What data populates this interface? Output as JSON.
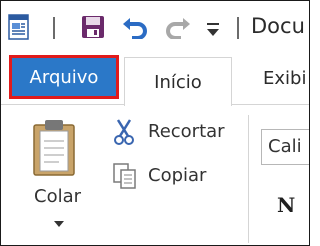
{
  "quick_access": {
    "icons": [
      "app-icon",
      "save-icon",
      "undo-icon",
      "redo-icon",
      "customize-dropdown-icon"
    ],
    "document_title": "Docu"
  },
  "tabs": [
    {
      "label": "Arquivo",
      "highlighted": true
    },
    {
      "label": "Início",
      "selected": true
    },
    {
      "label": "Exibi"
    }
  ],
  "clipboard": {
    "paste_label": "Colar",
    "cut_label": "Recortar",
    "copy_label": "Copiar"
  },
  "font": {
    "name_value": "Cali",
    "bold_label": "N"
  },
  "colors": {
    "file_tab_bg": "#2b78c8",
    "highlight_border": "#e01b1b",
    "save_icon": "#6b2a6b",
    "undo_icon": "#2b6cc4",
    "redo_icon": "#a8a8a8"
  }
}
